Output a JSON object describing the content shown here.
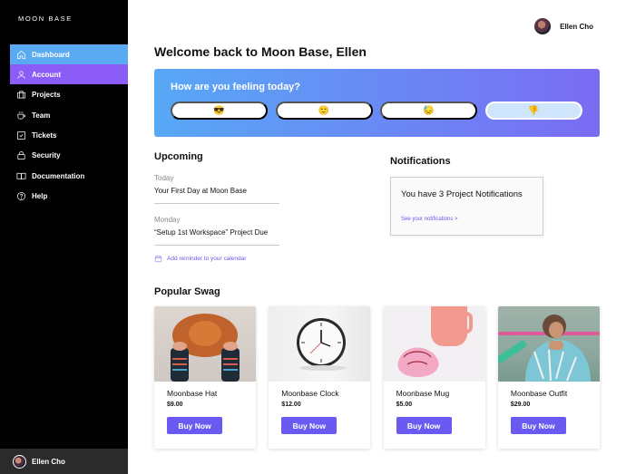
{
  "brand": "MOON BASE",
  "sidebar": {
    "items": [
      {
        "label": "Dashboard",
        "icon": "home-icon"
      },
      {
        "label": "Account",
        "icon": "user-icon"
      },
      {
        "label": "Projects",
        "icon": "briefcase-icon"
      },
      {
        "label": "Team",
        "icon": "coffee-icon"
      },
      {
        "label": "Tickets",
        "icon": "checkbox-icon"
      },
      {
        "label": "Security",
        "icon": "lock-icon"
      },
      {
        "label": "Documentation",
        "icon": "book-icon"
      },
      {
        "label": "Help",
        "icon": "help-circle-icon"
      }
    ],
    "user_name": "Ellen Cho"
  },
  "header": {
    "user_name": "Ellen Cho"
  },
  "main": {
    "title": "Welcome back to Moon Base, Ellen",
    "feeling": {
      "question": "How are you feeling today?",
      "options": [
        "😎",
        "🙂",
        "😓",
        "👎"
      ],
      "selected_index": 3
    },
    "upcoming": {
      "heading": "Upcoming",
      "items": [
        {
          "when": "Today",
          "what": "Your First Day at Moon Base"
        },
        {
          "when": "Monday",
          "what": "“Setup 1st Workspace” Project Due"
        }
      ],
      "add_reminder": "Add reminder to your calendar"
    },
    "notifications": {
      "heading": "Notifications",
      "message": "You have 3 Project Notifications",
      "link": "See your notifications >"
    },
    "swag": {
      "heading": "Popular Swag",
      "buy_label": "Buy Now",
      "products": [
        {
          "name": "Moonbase Hat",
          "price": "$9.00"
        },
        {
          "name": "Moonbase Clock",
          "price": "$12.00"
        },
        {
          "name": "Moonbase Mug",
          "price": "$5.00"
        },
        {
          "name": "Moonbase Outfit",
          "price": "$29.00"
        }
      ]
    }
  },
  "colors": {
    "accent": "#6a5af2",
    "sidebar_active_blue": "#5aa9f3",
    "sidebar_active_purple": "#8b5cf6",
    "sidebar_bg": "#000000"
  }
}
